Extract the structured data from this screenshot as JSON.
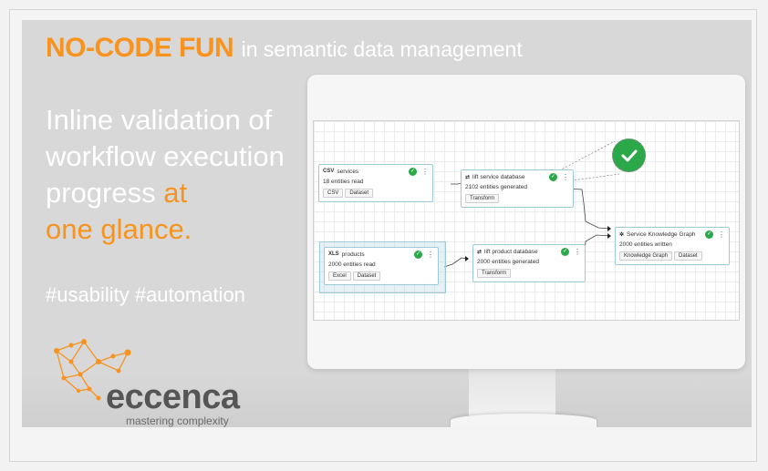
{
  "headline": {
    "highlight": "NO-CODE FUN",
    "rest": "in semantic data management"
  },
  "tagline": {
    "line1": "Inline validation of",
    "line2": "workflow execution",
    "line3_white": "progress ",
    "line3_orange": "at",
    "line4": "one glance."
  },
  "hashtags": "#usability #automation",
  "logo": {
    "name": "eccenca",
    "subtitle": "mastering complexity"
  },
  "colors": {
    "accent": "#f7931e",
    "success": "#2ba84a",
    "node_border": "#9ecad8"
  },
  "workflow": {
    "nodes": [
      {
        "type": "CSV",
        "title": "services",
        "count": "18 entities read",
        "tags": [
          "CSV",
          "Dataset"
        ]
      },
      {
        "type": "XLS",
        "title": "products",
        "count": "2000 entities read",
        "tags": [
          "Excel",
          "Dataset"
        ]
      },
      {
        "title": "lift service database",
        "count": "2102 entities generated",
        "tags": [
          "Transform"
        ]
      },
      {
        "title": "lift product database",
        "count": "2000 entities generated",
        "tags": [
          "Transform"
        ]
      },
      {
        "title": "Service Knowledge Graph",
        "count": "2000 entities written",
        "tags": [
          "Knowledge Graph",
          "Dataset"
        ]
      }
    ],
    "status_icon": "check-circle-icon",
    "menu_icon": "kebab-menu-icon"
  }
}
